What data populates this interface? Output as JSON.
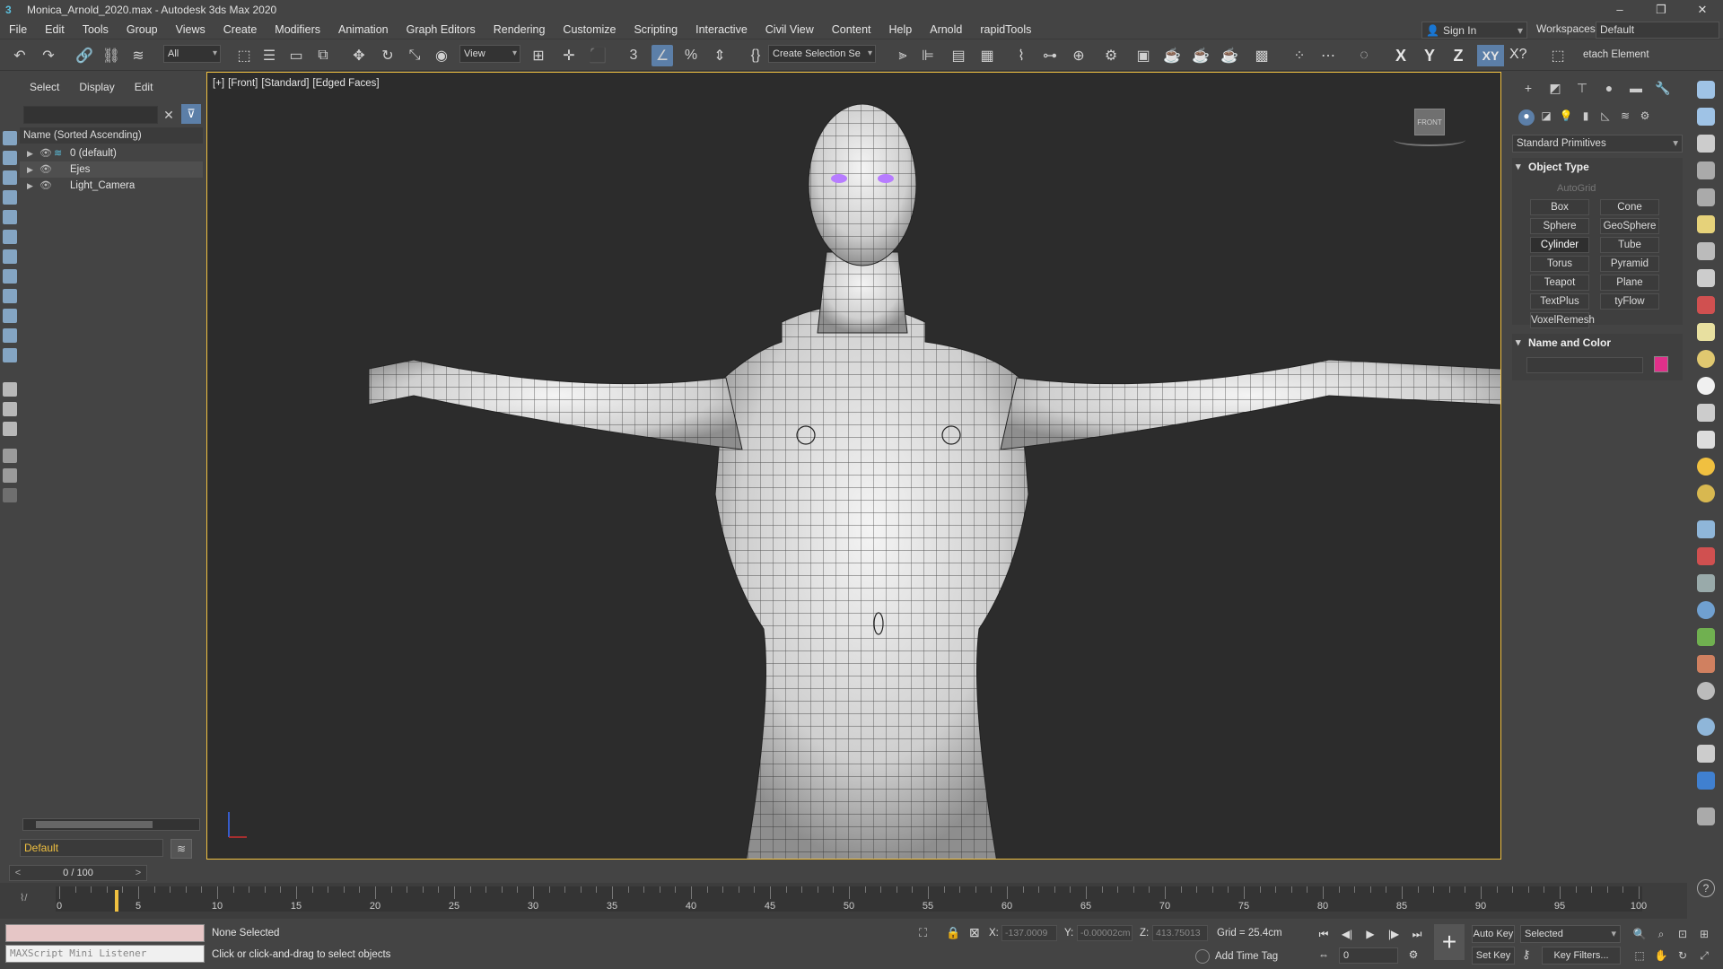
{
  "window": {
    "title": "Monica_Arnold_2020.max - Autodesk 3ds Max 2020",
    "controls": [
      "–",
      "❐",
      "✕"
    ]
  },
  "menu": [
    "File",
    "Edit",
    "Tools",
    "Group",
    "Views",
    "Create",
    "Modifiers",
    "Animation",
    "Graph Editors",
    "Rendering",
    "Customize",
    "Scripting",
    "Interactive",
    "Civil View",
    "Content",
    "Help",
    "Arnold",
    "rapidTools"
  ],
  "account": {
    "sign_in": "Sign In",
    "workspaces_label": "Workspaces:",
    "workspace": "Default"
  },
  "toolbar": {
    "filter_dropdown": "All",
    "ref_coord_dropdown": "View",
    "selection_set_dropdown": "Create Selection Se",
    "axis": [
      "X",
      "Y",
      "Z",
      "XY"
    ],
    "right_label": "etach Element"
  },
  "explorer": {
    "tabs": [
      "Select",
      "Display",
      "Edit"
    ],
    "column_header": "Name (Sorted Ascending)",
    "rows": [
      {
        "name": "0 (default)"
      },
      {
        "name": "Ejes"
      },
      {
        "name": "Light_Camera"
      }
    ],
    "layer": "Default"
  },
  "viewport": {
    "label_parts": [
      "[+]",
      "[Front]",
      "[Standard]",
      "[Edged Faces]"
    ],
    "viewcube_face": "FRONT"
  },
  "command_panel": {
    "primitive_type": "Standard Primitives",
    "object_type_title": "Object Type",
    "autogrid": "AutoGrid",
    "buttons": [
      "Box",
      "Cone",
      "Sphere",
      "GeoSphere",
      "Cylinder",
      "Tube",
      "Torus",
      "Pyramid",
      "Teapot",
      "Plane",
      "TextPlus",
      "tyFlow",
      "VoxelRemesh"
    ],
    "selected_button": "Cylinder",
    "name_color_title": "Name and Color",
    "object_color": "#e0308a"
  },
  "timeline": {
    "frame_display": "0 / 100",
    "ticks": [
      "0",
      "5",
      "10",
      "15",
      "20",
      "25",
      "30",
      "35",
      "40",
      "45",
      "50",
      "55",
      "60",
      "65",
      "70",
      "75",
      "80",
      "85",
      "90",
      "95",
      "100"
    ]
  },
  "status": {
    "maxscript_listener": "MAXScript Mini Listener",
    "selection": "None Selected",
    "prompt": "Click or click-and-drag to select objects",
    "x_label": "X:",
    "x_value": "-137.0009",
    "y_label": "Y:",
    "y_value": "-0.00002cm",
    "z_label": "Z:",
    "z_value": "413.75013",
    "grid": "Grid = 25.4cm",
    "add_time_tag": "Add Time Tag",
    "auto_key": "Auto Key",
    "set_key": "Set Key",
    "key_mode": "Selected",
    "key_filters": "Key Filters...",
    "current_frame": "0"
  },
  "colors": {
    "accent": "#5c7fa8",
    "viewport_border": "#f0c040",
    "viewport_bg": "#2c2c2c"
  }
}
